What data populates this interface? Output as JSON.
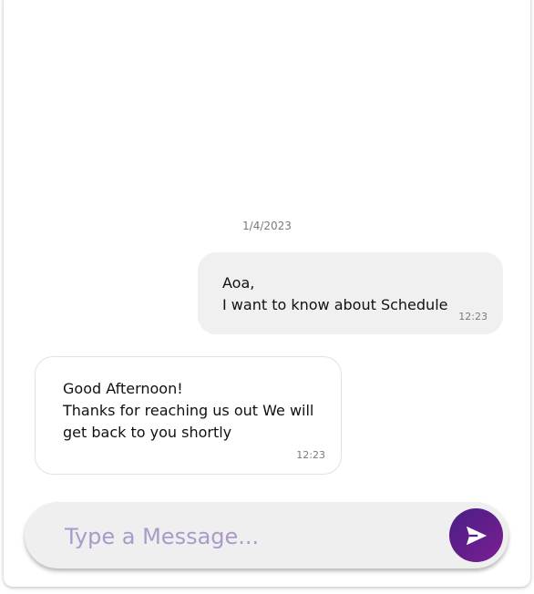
{
  "chat": {
    "date_label": "1/4/2023",
    "messages": [
      {
        "direction": "outgoing",
        "text": "Aoa,\nI want to know about Schedule",
        "time": "12:23"
      },
      {
        "direction": "incoming",
        "text": "Good Afternoon!\nThanks for reaching us out We will get back to you shortly",
        "time": "12:23"
      }
    ]
  },
  "composer": {
    "placeholder": "Type a Message...",
    "value": "",
    "send_icon": "send-icon"
  },
  "colors": {
    "outgoing_bubble": "#f0f0f0",
    "incoming_bubble": "#ffffff",
    "send_button_start": "#4a1e86",
    "send_button_end": "#7a1f91",
    "placeholder": "#a99ac9"
  }
}
